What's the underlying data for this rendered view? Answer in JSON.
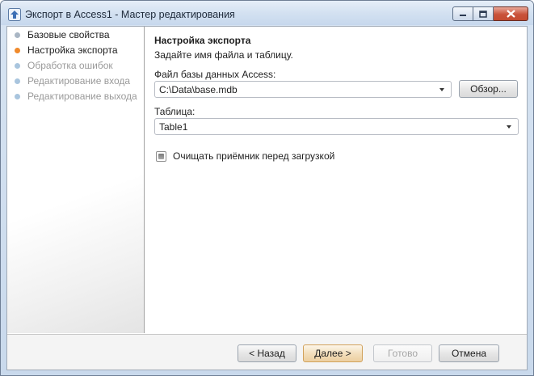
{
  "window": {
    "title": "Экспорт в Access1 - Мастер редактирования",
    "icon": "upload-arrow-icon"
  },
  "colors": {
    "step_done": "#a9b6c4",
    "step_active": "#f08a2c",
    "step_pending": "#a9c5de",
    "text_active": "#1e1e1e",
    "text_inactive": "#9a9a9a"
  },
  "steps": [
    {
      "label": "Базовые свойства",
      "state": "done"
    },
    {
      "label": "Настройка экспорта",
      "state": "active"
    },
    {
      "label": "Обработка ошибок",
      "state": "pending"
    },
    {
      "label": "Редактирование входа",
      "state": "pending"
    },
    {
      "label": "Редактирование выхода",
      "state": "pending"
    }
  ],
  "main": {
    "heading": "Настройка экспорта",
    "subheading": "Задайте имя файла и таблицу.",
    "db_label": "Файл базы данных Access:",
    "db_value": "C:\\Data\\base.mdb",
    "browse_label": "Обзор...",
    "table_label": "Таблица:",
    "table_value": "Table1",
    "clear_label": "Очищать приёмник перед загрузкой",
    "clear_checked": "indeterminate"
  },
  "footer": {
    "back_label": "< Назад",
    "next_label": "Далее >",
    "finish_label": "Готово",
    "cancel_label": "Отмена"
  }
}
